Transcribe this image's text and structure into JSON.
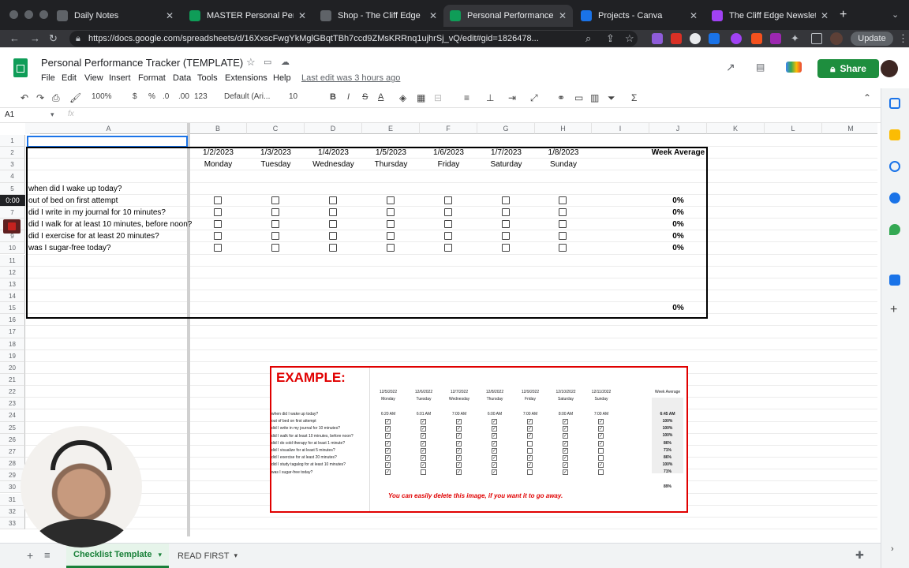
{
  "browser": {
    "tabs": [
      {
        "title": "Daily Notes",
        "color": "#5f6368"
      },
      {
        "title": "MASTER Personal Perfor",
        "color": "#0f9d58"
      },
      {
        "title": "Shop - The Cliff Edge",
        "color": "#5f6368"
      },
      {
        "title": "Personal Performance Tr",
        "color": "#0f9d58"
      },
      {
        "title": "Projects - Canva",
        "color": "#1a73e8"
      },
      {
        "title": "The Cliff Edge Newslette",
        "color": "#a142f4"
      }
    ],
    "url": "https://docs.google.com/spreadsheets/d/16XxscFwgYkMglGBqtTBh7ccd9ZMsKRRnq1ujhrSj_vQ/edit#gid=1826478...",
    "update_label": "Update",
    "new_tab": "+"
  },
  "sheets": {
    "doc_title": "Personal Performance Tracker (TEMPLATE)",
    "menus": [
      "File",
      "Edit",
      "View",
      "Insert",
      "Format",
      "Data",
      "Tools",
      "Extensions",
      "Help"
    ],
    "last_edit": "Last edit was 3 hours ago",
    "share_label": "Share",
    "toolbar": {
      "zoom": "100%",
      "currency": "$",
      "percent": "%",
      "dec_less": ".0",
      "dec_more": ".00",
      "format": "123",
      "font": "Default (Ari...",
      "size": "10",
      "bold": "B",
      "italic": "I",
      "strike": "S",
      "text_color": "A"
    },
    "name_box": "A1",
    "fx": "fx"
  },
  "grid": {
    "columns": [
      "A",
      "B",
      "C",
      "D",
      "E",
      "F",
      "G",
      "H",
      "I",
      "J",
      "K",
      "L",
      "M"
    ],
    "rows": [
      "1",
      "2",
      "3",
      "4",
      "5",
      "6",
      "7",
      "8",
      "9",
      "10",
      "11",
      "12",
      "13",
      "14",
      "15",
      "16",
      "17",
      "18",
      "19",
      "20",
      "21",
      "22",
      "23",
      "24",
      "25",
      "26",
      "27",
      "28",
      "29",
      "30",
      "31",
      "32",
      "33"
    ],
    "dates": [
      "1/2/2023",
      "1/3/2023",
      "1/4/2023",
      "1/5/2023",
      "1/6/2023",
      "1/7/2023",
      "1/8/2023"
    ],
    "days": [
      "Monday",
      "Tuesday",
      "Wednesday",
      "Thursday",
      "Friday",
      "Saturday",
      "Sunday"
    ],
    "week_average_label": "Week Average",
    "questions": [
      "when did I wake up today?",
      "out of bed on first attempt",
      "did I write in my journal for 10 minutes?",
      "did I walk for at least 10 minutes, before noon?",
      "did I exercise for at least 20 minutes?",
      "was I sugar-free today?"
    ],
    "averages": [
      "0%",
      "0%",
      "0%",
      "0%",
      "0%"
    ],
    "total_average": "0%",
    "timer_overlay": "0:00"
  },
  "example": {
    "title": "EXAMPLE:",
    "dates": [
      "12/5/2022",
      "12/6/2022",
      "12/7/2022",
      "12/8/2022",
      "12/9/2022",
      "12/10/2022",
      "12/11/2022"
    ],
    "days": [
      "Monday",
      "Tuesday",
      "Wednesday",
      "Thursday",
      "Friday",
      "Saturday",
      "Sunday"
    ],
    "week_average_label": "Week Average",
    "wake_times": [
      "6:20 AM",
      "6:01 AM",
      "7:00 AM",
      "6:00 AM",
      "7:00 AM",
      "8:00 AM",
      "7:00 AM"
    ],
    "wake_average": "6:45 AM",
    "questions": [
      "when did I wake up today?",
      "out of bed on first attempt",
      "did I write in my journal for 10 minutes?",
      "did I walk for at least 10 minutes, before noon?",
      "did I do cold therapy for at least 1 minute?",
      "did I visualize for at least 5 minutes?",
      "did I exercise for at least 20 minutes?",
      "did I study tagalog for at least 10 minutes?",
      "was I sugar-free today?"
    ],
    "averages": [
      "100%",
      "100%",
      "100%",
      "86%",
      "71%",
      "86%",
      "100%",
      "71%"
    ],
    "total_average": "89%",
    "note": "You can easily delete this image, if you want it to go away."
  },
  "sheet_tabs": {
    "add": "+",
    "list": "≡",
    "active": "Checklist Template",
    "other": "READ FIRST"
  }
}
